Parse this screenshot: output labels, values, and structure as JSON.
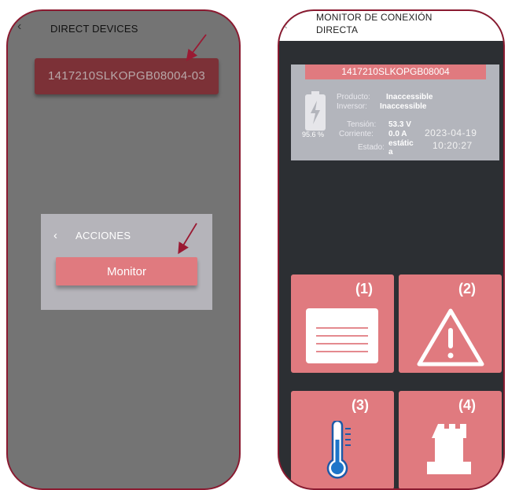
{
  "left_screen": {
    "header": {
      "back_icon": "chevron-left-icon",
      "title": "DIRECT DEVICES"
    },
    "device_card": {
      "id": "1417210SLKOPGB08004-03"
    },
    "dialog": {
      "back_icon": "chevron-left-icon",
      "title": "ACCIONES",
      "monitor_button": "Monitor"
    }
  },
  "right_screen": {
    "header": {
      "back_icon": "chevron-left-icon",
      "title_line1": "MONITOR DE CONEXIÓN",
      "title_line2": "DIRECTA"
    },
    "status": {
      "serial": "1417210SLKOPGB08004",
      "battery_percent": "95.6 %",
      "producto_label": "Producto:",
      "producto_value": "Inaccessible",
      "inversor_label": "Inversor:",
      "inversor_value": "Inaccessible",
      "tension_label": "Tensión:",
      "tension_value": "53.3 V",
      "corriente_label": "Corriente:",
      "corriente_value": "0.0 A",
      "estado_label": "Estado:",
      "estado_value_line1": "estátic",
      "estado_value_line2": "a",
      "date": "2023-04-19",
      "time": "10:20:27"
    },
    "tiles": [
      {
        "label": "(1)",
        "icon": "document-lines-icon"
      },
      {
        "label": "(2)",
        "icon": "warning-icon"
      },
      {
        "label": "(3)",
        "icon": "thermometer-icon"
      },
      {
        "label": "(4)",
        "icon": "castle-tower-icon"
      }
    ]
  },
  "colors": {
    "accent": "#e07a7f",
    "border": "#8a1a30",
    "arrow": "#9a1a33",
    "panel": "#b3b5bc",
    "dark_bg": "#2c2f33"
  }
}
